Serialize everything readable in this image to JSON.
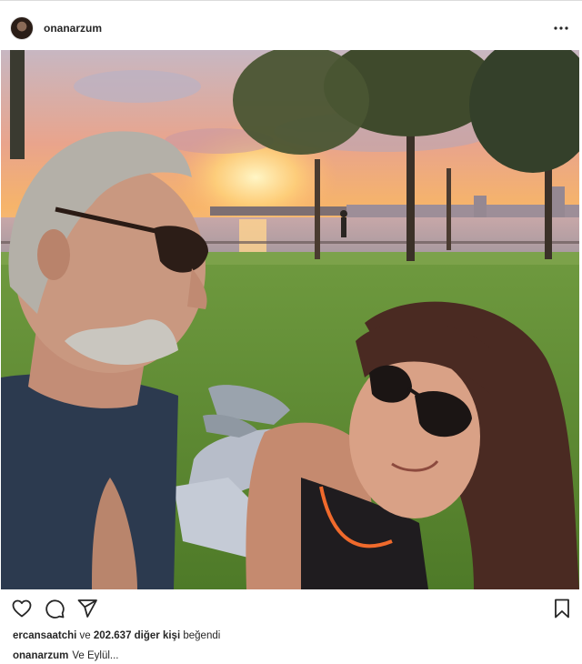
{
  "post": {
    "username": "onanarzum",
    "photo_icon": "photo",
    "more_icon": "more-horizontal-icon"
  },
  "actions": {
    "like_icon": "heart-icon",
    "comment_icon": "comment-icon",
    "share_icon": "share-icon",
    "save_icon": "bookmark-icon"
  },
  "likes": {
    "user": "ercansaatchi",
    "connector": "ve",
    "count_text": "202.637 diğer kişi",
    "suffix": "beğendi"
  },
  "caption": {
    "username": "onanarzum",
    "text": "Ve Eylül..."
  },
  "colors": {
    "text": "#262626",
    "border": "#dbdbdb",
    "background": "#ffffff"
  }
}
